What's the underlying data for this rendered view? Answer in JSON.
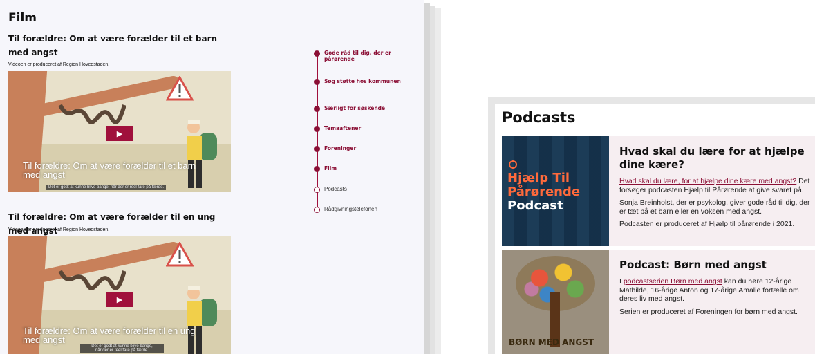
{
  "film": {
    "title": "Film",
    "videos": [
      {
        "heading": "Til forældre: Om at være forælder til et barn med angst",
        "producer": "Videoen er produceret af Region Hovedstaden.",
        "caption": "Til forældre: Om at være forælder til et barn med angst",
        "subtitle": "Det er godt at kunne blive bange, når der er reel fare på færde.",
        "play_icon": "play-icon"
      },
      {
        "heading": "Til forældre: Om at være forælder til en ung med angst",
        "producer": "Videoen er produceret af Region Hovedstaden.",
        "caption": "Til forældre: Om at være forælder til en ung med angst",
        "subtitle_line1": "Det er godt at kunne blive bange,",
        "subtitle_line2": "når der er reel fare på færde.",
        "play_icon": "play-icon"
      }
    ]
  },
  "side_nav": {
    "items": [
      {
        "label": "Gode råd til dig, der er pårørende",
        "visited": true
      },
      {
        "label": "Søg støtte hos kommunen",
        "visited": true
      },
      {
        "label": "Særligt for søskende",
        "visited": true
      },
      {
        "label": "Temaaftener",
        "visited": true
      },
      {
        "label": "Foreninger",
        "visited": true
      },
      {
        "label": "Film",
        "visited": true
      },
      {
        "label": "Podcasts",
        "visited": false
      },
      {
        "label": "Rådgivningstelefonen",
        "visited": false
      }
    ]
  },
  "podcasts": {
    "title": "Podcasts",
    "items": [
      {
        "image_text_line1": "Hjælp Til",
        "image_text_line2": "Pårørende",
        "image_text_line3": "Podcast",
        "heading": "Hvad skal du lære for at hjælpe dine kære?",
        "link_text": "Hvad skal du lære, for at hjælpe dine kære med angst?",
        "para1_rest": " Det forsøger podcasten Hjælp til Pårørende at give svaret på.",
        "para2": "Sonja Breinholst, der er psykolog, giver gode råd til dig, der er tæt på et barn eller en voksen med angst.",
        "para3": "Podcasten er produceret af Hjælp til pårørende i 2021."
      },
      {
        "image_text": "BØRN MED ANGST",
        "heading": "Podcast: Børn med angst",
        "para1_prefix": "I ",
        "link_text": "podcastserien Børn med angst",
        "para1_rest": " kan du høre 12-årige Mathilde, 16-årige Anton og 17-årige Amalie fortælle om deres liv med angst.",
        "para2": "Serien er produceret af Foreningen for børn med angst."
      }
    ]
  },
  "colors": {
    "accent": "#8b0f35",
    "play_button": "#a0103c",
    "card_bg": "#f6eef1"
  }
}
